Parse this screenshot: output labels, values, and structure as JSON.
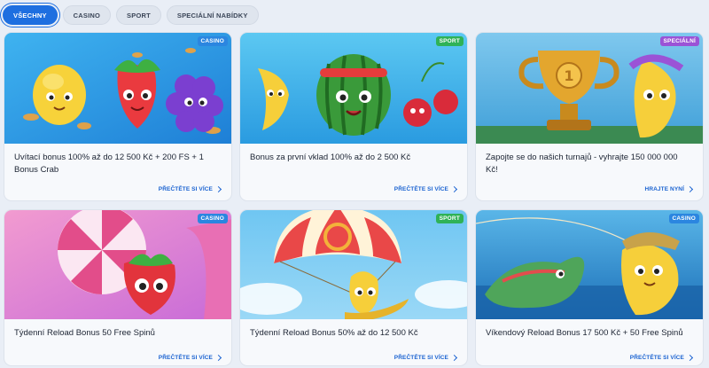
{
  "tabs": [
    {
      "label": "VŠECHNY",
      "active": true
    },
    {
      "label": "CASINO",
      "active": false
    },
    {
      "label": "SPORT",
      "active": false
    },
    {
      "label": "SPECIÁLNÍ NABÍDKY",
      "active": false
    }
  ],
  "badge_colors": {
    "CASINO": "#2b86e0",
    "SPORT": "#2fb257",
    "SPECIÁLNÍ": "#9b53d6"
  },
  "cards": [
    {
      "badge": "CASINO",
      "title": "Uvítací bonus 100% až do 12 500 Kč + 200 FS + 1 Bonus Crab",
      "link": "PŘEČTĚTE SI VÍCE",
      "art": "fruits-lemon-strawberry-grapes"
    },
    {
      "badge": "SPORT",
      "title": "Bonus za první vklad 100% až do 2 500 Kč",
      "link": "PŘEČTĚTE SI VÍCE",
      "art": "banana-watermelon-cherries"
    },
    {
      "badge": "SPECIÁLNÍ",
      "title": "Zapojte se do našich turnajů - vyhrajte 150 000 000 Kč!",
      "link": "HRAJTE NYNÍ",
      "art": "trophy-banana"
    },
    {
      "badge": "CASINO",
      "title": "Týdenní Reload Bonus 50 Free Spinů",
      "link": "PŘEČTĚTE SI VÍCE",
      "art": "candy-strawberry"
    },
    {
      "badge": "SPORT",
      "title": "Týdenní Reload Bonus 50% až do 12 500 Kč",
      "link": "PŘEČTĚTE SI VÍCE",
      "art": "parachute-banana"
    },
    {
      "badge": "CASINO",
      "title": "Víkendový Reload Bonus 17 500 Kč + 50 Free Spinů",
      "link": "PŘEČTĚTE SI VÍCE",
      "art": "fishing-banana"
    }
  ]
}
